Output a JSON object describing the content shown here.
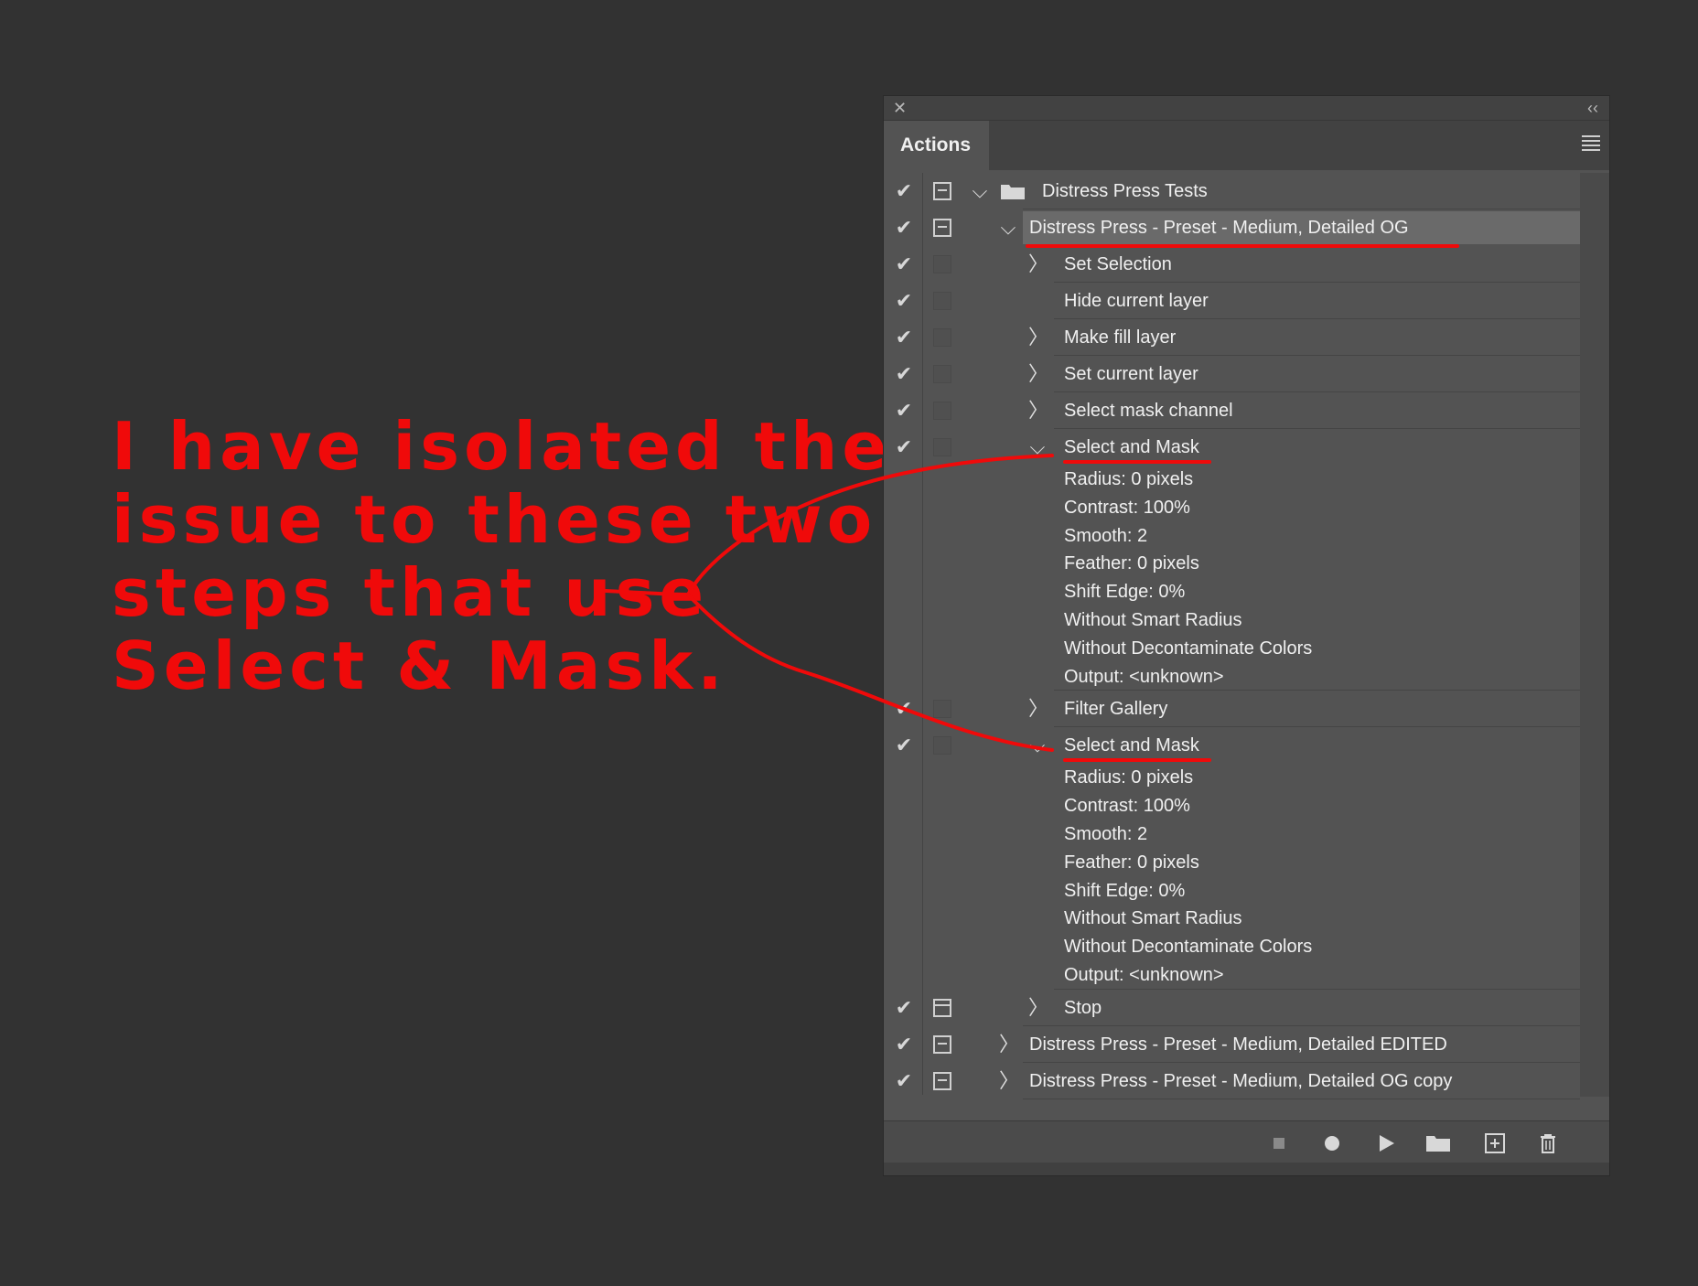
{
  "annotation": {
    "lines": [
      "I have isolated the",
      "issue to these two",
      "steps that use",
      "Select & Mask."
    ],
    "color": "#f00a0a"
  },
  "panel": {
    "tab_label": "Actions",
    "close_icon": "close-icon",
    "collapse_icon": "double-chevron-left-icon",
    "menu_icon": "panel-menu-icon",
    "rows": [
      {
        "label": "Distress Press Tests",
        "kind": "set"
      },
      {
        "label": "Distress Press - Preset - Medium, Detailed OG",
        "kind": "action",
        "expanded": true,
        "selected": true
      },
      {
        "label": "Set Selection",
        "kind": "step"
      },
      {
        "label": "Hide current layer",
        "kind": "step"
      },
      {
        "label": "Make fill layer",
        "kind": "step"
      },
      {
        "label": "Set current layer",
        "kind": "step"
      },
      {
        "label": "Select mask channel",
        "kind": "step"
      },
      {
        "label": "Select and Mask",
        "kind": "step",
        "expanded": true
      },
      {
        "label": "Filter Gallery",
        "kind": "step"
      },
      {
        "label": "Select and Mask",
        "kind": "step",
        "expanded": true
      },
      {
        "label": "Stop",
        "kind": "step"
      },
      {
        "label": "Distress Press - Preset - Medium, Detailed EDITED",
        "kind": "action"
      },
      {
        "label": "Distress Press - Preset - Medium, Detailed OG copy",
        "kind": "action"
      }
    ],
    "select_and_mask_params": [
      "Radius: 0 pixels",
      "Contrast: 100%",
      "Smooth: 2",
      "Feather: 0 pixels",
      "Shift Edge: 0%",
      "Without Smart Radius",
      "Without Decontaminate Colors",
      "Output: <unknown>"
    ],
    "bottom_icons": [
      "stop-icon",
      "record-icon",
      "play-icon",
      "new-set-folder-icon",
      "new-action-icon",
      "trash-icon"
    ]
  }
}
